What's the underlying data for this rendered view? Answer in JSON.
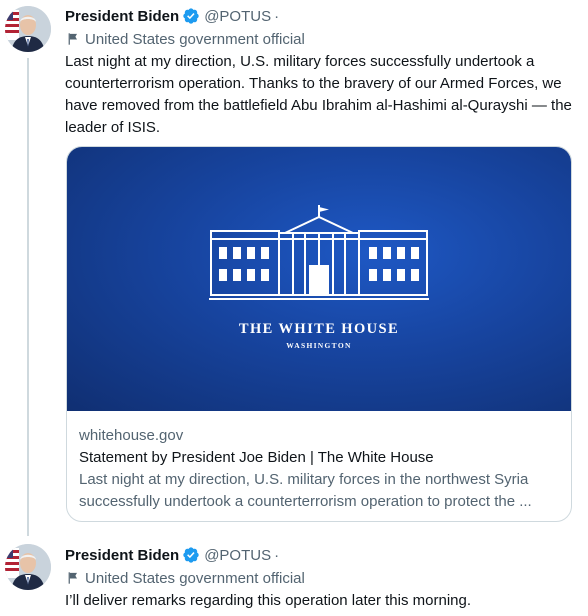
{
  "colors": {
    "accent": "#1d9bf0",
    "text": "#0f1419",
    "secondary": "#536471",
    "card_bg": "#17449f"
  },
  "tweets": [
    {
      "author_name": "President Biden",
      "handle": "@POTUS",
      "separator": "·",
      "label": "United States government official",
      "text": "Last night at my direction, U.S. military forces successfully undertook a counterterrorism operation. Thanks to the bravery of our Armed Forces, we have removed from the battlefield Abu Ibrahim al-Hashimi al-Qurayshi — the leader of ISIS.",
      "card": {
        "image_title": "THE WHITE HOUSE",
        "image_subtitle": "WASHINGTON",
        "domain": "whitehouse.gov",
        "title": "Statement by President Joe Biden | The White House",
        "description": "Last night at my direction, U.S. military forces in the northwest Syria successfully undertook a counterterrorism operation to protect the ..."
      }
    },
    {
      "author_name": "President Biden",
      "handle": "@POTUS",
      "separator": "·",
      "label": "United States government official",
      "text": "I’ll deliver remarks regarding this operation later this morning."
    }
  ]
}
